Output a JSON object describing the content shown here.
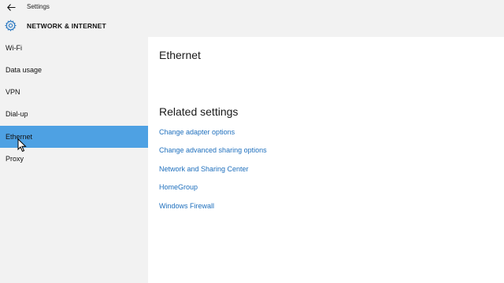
{
  "window": {
    "title": "Settings"
  },
  "header": {
    "title": "NETWORK & INTERNET"
  },
  "sidebar": {
    "items": [
      {
        "label": "Wi-Fi"
      },
      {
        "label": "Data usage"
      },
      {
        "label": "VPN"
      },
      {
        "label": "Dial-up"
      },
      {
        "label": "Ethernet",
        "selected": true
      },
      {
        "label": "Proxy"
      }
    ]
  },
  "main": {
    "title": "Ethernet",
    "related_title": "Related settings",
    "links": [
      {
        "label": "Change adapter options"
      },
      {
        "label": "Change advanced sharing options"
      },
      {
        "label": "Network and Sharing Center"
      },
      {
        "label": "HomeGroup"
      },
      {
        "label": "Windows Firewall"
      }
    ]
  },
  "icons": {
    "back": "back-arrow-icon",
    "gear": "gear-icon",
    "cursor": "mouse-pointer-icon"
  },
  "colors": {
    "selected": "#4ea1e3",
    "link": "#1e6fbd",
    "chrome": "#f2f2f2"
  }
}
